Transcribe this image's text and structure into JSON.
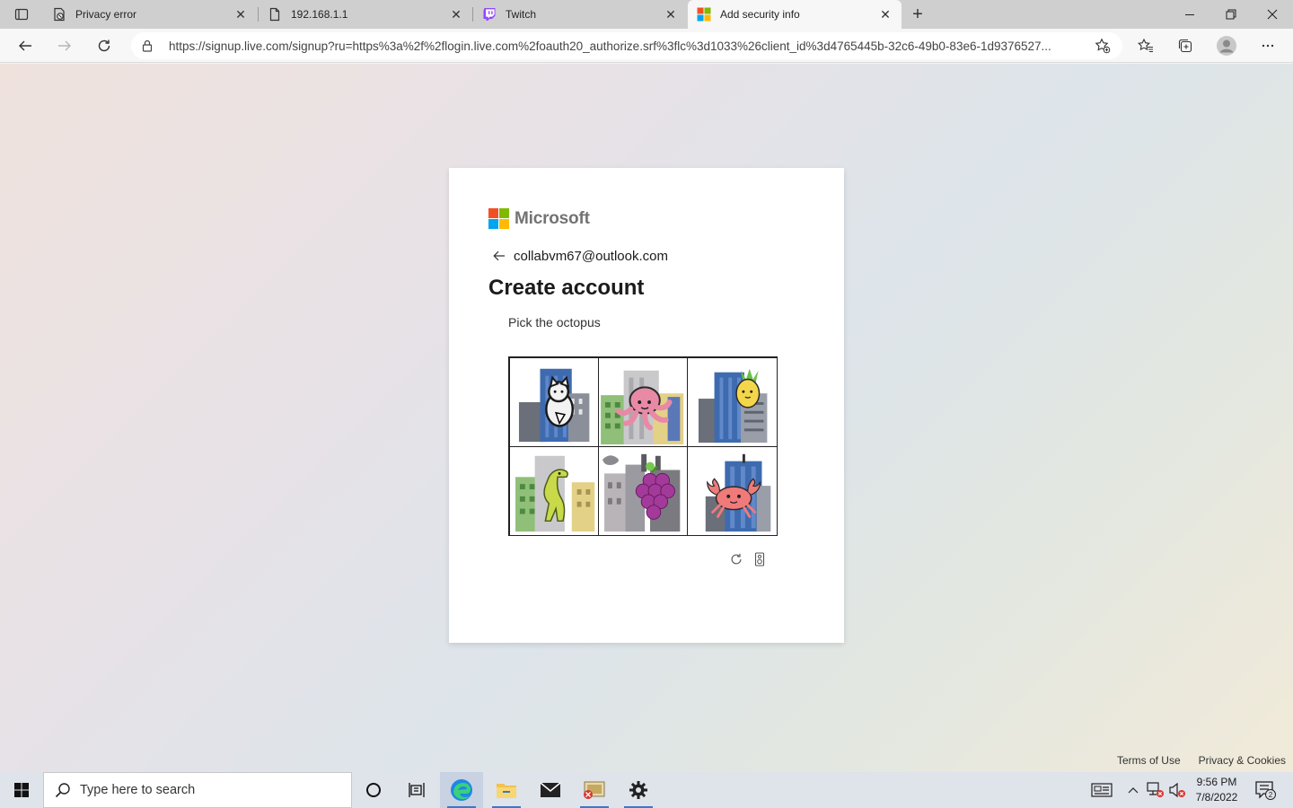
{
  "browser": {
    "tabs": [
      {
        "title": "Privacy error",
        "icon": "privacy-error-icon",
        "active": false
      },
      {
        "title": "192.168.1.1",
        "icon": "page-icon",
        "active": false
      },
      {
        "title": "Twitch",
        "icon": "twitch-icon",
        "active": false
      },
      {
        "title": "Add security info",
        "icon": "microsoft-icon",
        "active": true
      }
    ],
    "address_url": "https://signup.live.com/signup?ru=https%3a%2f%2flogin.live.com%2foauth20_authorize.srf%3flc%3d1033%26client_id%3d4765445b-32c6-49b0-83e6-1d9376527..."
  },
  "card": {
    "brand": "Microsoft",
    "identity_email": "collabvm67@outlook.com",
    "heading": "Create account",
    "instruction": "Pick the octopus",
    "puzzle_tiles": [
      "cat",
      "octopus",
      "pineapple",
      "dinosaur",
      "grapes",
      "crab"
    ]
  },
  "footer": {
    "terms": "Terms of Use",
    "privacy": "Privacy & Cookies"
  },
  "taskbar": {
    "search_placeholder": "Type here to search",
    "time": "9:56 PM",
    "date": "7/8/2022",
    "notification_count": "2"
  },
  "colors": {
    "ms_red": "#f25022",
    "ms_green": "#7fba00",
    "ms_blue": "#00a4ef",
    "ms_yellow": "#ffb900",
    "edge_blue": "#1e88e5",
    "twitch_purple": "#9146ff"
  }
}
